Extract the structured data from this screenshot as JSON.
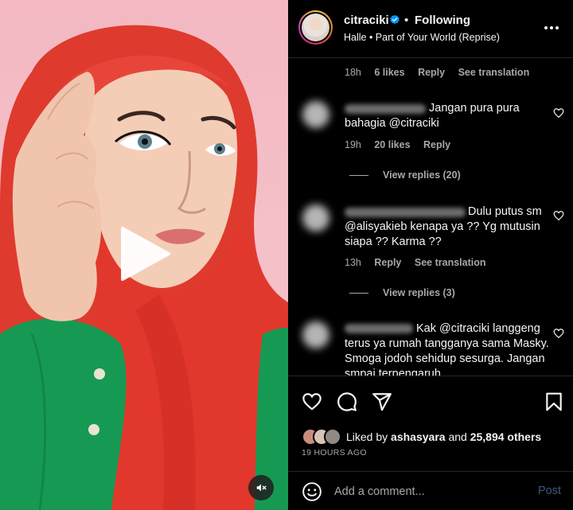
{
  "post": {
    "username": "citraciki",
    "separator": "•",
    "follow_status": "Following",
    "audio": "Halle • Part of Your World (Reprise)"
  },
  "icons": {
    "verified": "verified-badge-icon",
    "more": "more-options-icon",
    "play": "play-icon",
    "mute": "muted-speaker-icon",
    "like": "heart-icon",
    "comment": "comment-bubble-icon",
    "share": "paper-plane-icon",
    "save": "bookmark-icon",
    "emoji": "emoji-smile-icon"
  },
  "comments": {
    "first_meta": {
      "time": "18h",
      "likes": "6 likes",
      "reply": "Reply",
      "translate": "See translation"
    },
    "items": [
      {
        "text": "Jangan pura pura bahagia @citraciki",
        "time": "19h",
        "likes": "20 likes",
        "reply": "Reply",
        "view_replies": "View replies (20)"
      },
      {
        "text": "Dulu putus sm @alisyakieb kenapa ya ?? Yg mutusin siapa ?? Karma ??",
        "time": "13h",
        "reply": "Reply",
        "translate": "See translation",
        "view_replies": "View replies (3)"
      },
      {
        "text": "Kak @citraciki langgeng terus ya rumah tangganya sama Masky. Smoga jodoh sehidup sesurga. Jangan smpai terpengaruh"
      }
    ]
  },
  "likes": {
    "prefix": "Liked by",
    "user": "ashasyara",
    "conj": "and",
    "others": "25,894 others",
    "time_ago": "19 HOURS AGO"
  },
  "add_comment": {
    "placeholder": "Add a comment...",
    "post_label": "Post"
  },
  "colors": {
    "background": "#000000",
    "text": "#f5f5f5",
    "secondary_text": "#a8a8a8",
    "verified": "#0095f6",
    "post_disabled": "#3c5a7a",
    "hijab_red": "#e2372c",
    "shirt_green": "#169a53",
    "backdrop_pink": "#f4bcc4"
  }
}
